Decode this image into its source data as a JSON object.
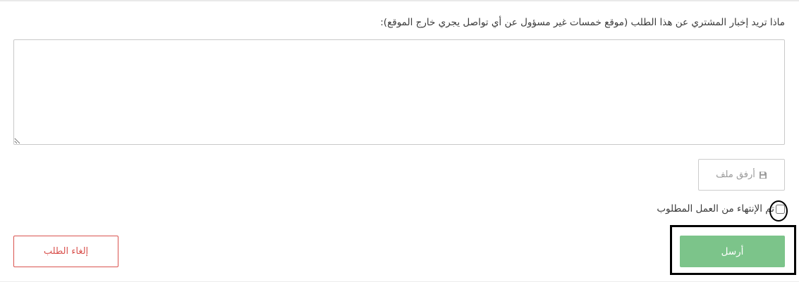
{
  "form": {
    "question_label": "ماذا تريد إخبار المشتري عن هذا الطلب (موقع خمسات غير مسؤول عن أي تواصل يجري خارج الموقع):",
    "message_value": "",
    "attach_label": "أرفق ملف",
    "attach_icon": "save-icon",
    "done_label": "تم الإنتهاء من العمل المطلوب",
    "done_checked": false,
    "cancel_label": "إلغاء الطلب",
    "submit_label": "أرسل"
  },
  "colors": {
    "submit_bg": "#7cc48a",
    "cancel_accent": "#d9534f",
    "border": "#cccccc",
    "text": "#3a3a3a",
    "muted_text": "#9a9a9a"
  }
}
